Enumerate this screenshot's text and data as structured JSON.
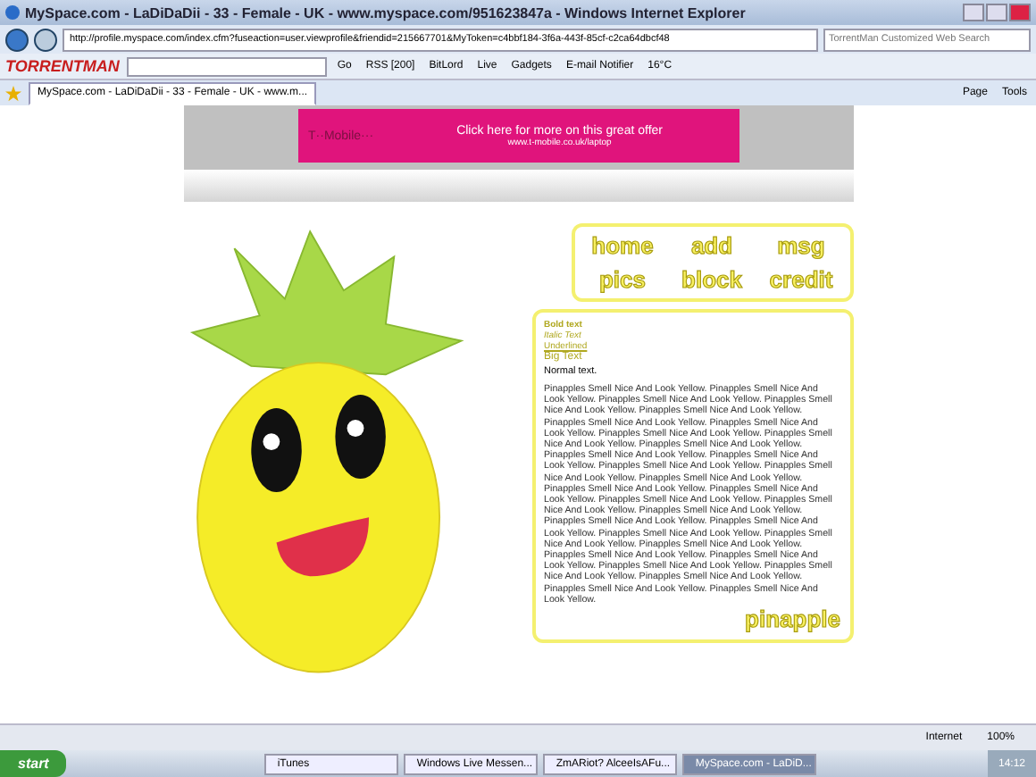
{
  "window": {
    "title": "MySpace.com - LaDiDaDii - 33 - Female - UK - www.myspace.com/951623847a - Windows Internet Explorer"
  },
  "address_bar": {
    "url": "http://profile.myspace.com/index.cfm?fuseaction=user.viewprofile&friendid=215667701&MyToken=c4bbf184-3f6a-443f-85cf-c2ca64dbcf48",
    "search_placeholder": "TorrentMan Customized Web Search"
  },
  "toolbar": {
    "logo": "TORRENTMAN",
    "items": [
      "Go",
      "RSS [200]",
      "BitLord",
      "Live",
      "Gadgets",
      "E-mail Notifier",
      "16°C"
    ]
  },
  "tabs": [
    {
      "label": "MySpace.com - LaDiDaDii - 33 - Female - UK - www.m...",
      "selected": true
    }
  ],
  "command_bar": [
    "Page",
    "Tools"
  ],
  "ad": {
    "brand": "T··Mobile···",
    "headline": "Click here for more on this great offer",
    "url": "www.t-mobile.co.uk/laptop"
  },
  "nav_links": [
    "home",
    "add",
    "msg",
    "pics",
    "block",
    "credit"
  ],
  "text_box": {
    "styled_lines": [
      "Bold text",
      "Italic Text",
      "Underlined",
      "Big Text"
    ],
    "normal": "Normal text.",
    "paragraph": "Pinapples Smell Nice And Look Yellow. Pinapples Smell Nice And Look Yellow. Pinapples Smell Nice And Look Yellow. Pinapples Smell Nice And Look Yellow. Pinapples Smell Nice And Look Yellow. Pinapples Smell Nice And Look Yellow. Pinapples Smell Nice And Look Yellow. Pinapples Smell Nice And Look Yellow. Pinapples Smell Nice And Look Yellow. Pinapples Smell Nice And Look Yellow. Pinapples Smell Nice And Look Yellow. Pinapples Smell Nice And Look Yellow. Pinapples Smell Nice And Look Yellow. Pinapples Smell Nice And Look Yellow. Pinapples Smell Nice And Look Yellow. Pinapples Smell Nice And Look Yellow. Pinapples Smell Nice And Look Yellow. Pinapples Smell Nice And Look Yellow. Pinapples Smell Nice And Look Yellow. Pinapples Smell Nice And Look Yellow. Pinapples Smell Nice And Look Yellow. Pinapples Smell Nice And Look Yellow. Pinapples Smell Nice And Look Yellow. Pinapples Smell Nice And Look Yellow. Pinapples Smell Nice And Look Yellow. Pinapples Smell Nice And Look Yellow. Pinapples Smell Nice And Look Yellow. Pinapples Smell Nice And Look Yellow. Pinapples Smell Nice And Look Yellow. Pinapples Smell Nice And Look Yellow. Pinapples Smell Nice And Look Yellow. Pinapples Smell Nice And Look Yellow.",
    "signature": "pinapple"
  },
  "status_bar": {
    "zone": "Internet",
    "zoom": "100%"
  },
  "taskbar": {
    "start": "start",
    "tasks": [
      {
        "label": "iTunes",
        "selected": false
      },
      {
        "label": "Windows Live Messen...",
        "selected": false
      },
      {
        "label": "ZmARiot? AlceeIsAFu...",
        "selected": false
      },
      {
        "label": "MySpace.com - LaDiD...",
        "selected": true
      }
    ],
    "clock": "14:12"
  }
}
